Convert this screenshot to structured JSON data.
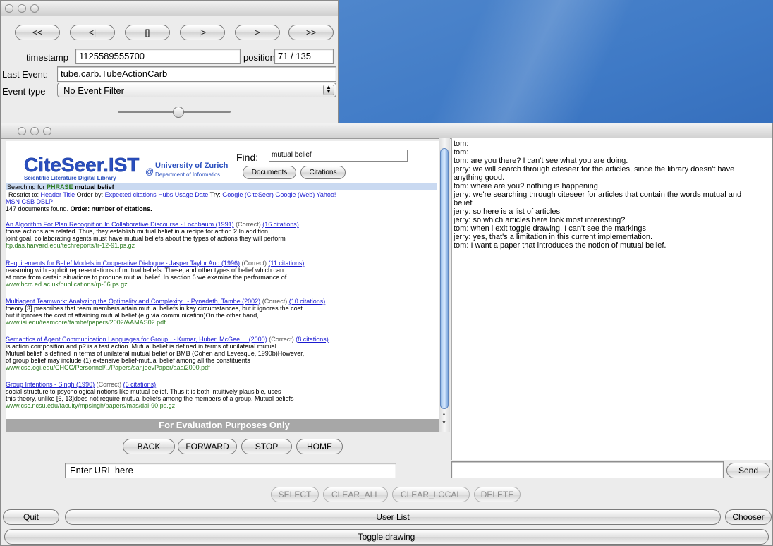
{
  "player": {
    "nav_buttons": [
      "<<",
      "<|",
      "[]",
      "|>",
      ">",
      ">>"
    ],
    "timestamp_label": "timestamp",
    "timestamp_value": "1125589555700",
    "position_label": "position",
    "position_value": "71 / 135",
    "last_event_label": "Last Event:",
    "last_event_value": "tube.carb.TubeActionCarb",
    "event_type_label": "Event type",
    "event_type_value": "No Event Filter"
  },
  "browser": {
    "brand": "CiteSeer.IST",
    "brand_sub": "Scientific Literature Digital Library",
    "at": "@",
    "uni": "University of Zurich",
    "dept": "Department of Informatics",
    "find_label": "Find:",
    "find_value": "mutual belief",
    "documents_btn": "Documents",
    "citations_btn": "Citations",
    "searching_prefix": "Searching for",
    "searching_phrase": "PHRASE",
    "searching_term": "mutual belief",
    "restrict_label": "Restrict to:",
    "restrict_links": [
      "Header",
      "Title"
    ],
    "order_label": "Order by:",
    "order_links": [
      "Expected citations",
      "Hubs",
      "Usage",
      "Date"
    ],
    "try_label": "Try:",
    "try_links": [
      "Google (CiteSeer)",
      "Google (Web)",
      "Yahoo!",
      "MSN",
      "CSB",
      "DBLP"
    ],
    "count_text": "147 documents found.",
    "order_text": "Order: number of citations.",
    "results": [
      {
        "title": "An Algorithm For Plan Recognition In Collaborative Discourse - Lochbaum (1991)",
        "status": "(Correct)",
        "cites": "(16 citations)",
        "lines": [
          "those actions are related. Thus, they establish mutual belief in a recipe for action 2 In addition,",
          "joint goal, collaborating agents must have mutual beliefs about the types of actions they will perform"
        ],
        "url": "ftp.das.harvard.edu/techreports/tr-12-91.ps.gz"
      },
      {
        "title": "Requirements for Belief Models in Cooperative Dialogue - Jasper Taylor And (1996)",
        "status": "(Correct)",
        "cites": "(11 citations)",
        "lines": [
          "reasoning with explicit representations of mutual beliefs. These, and other types of belief which can",
          "at once from certain situations to produce mutual belief. In section 6 we examine the performance of"
        ],
        "url": "www.hcrc.ed.ac.uk/publications/rp-66.ps.gz"
      },
      {
        "title": "Multiagent Teamwork: Analyzing the Optimality and Complexity.. - Pynadath, Tambe (2002)",
        "status": "(Correct)",
        "cites": "(10 citations)",
        "lines": [
          "theory [3] prescribes that team members attain mutual beliefs in key circumstances, but it ignores the cost",
          "but it ignores the cost of attaining mutual belief (e.g.via communication)On the other hand,"
        ],
        "url": "www.isi.edu/teamcore/tambe/papers/2002/AAMAS02.pdf"
      },
      {
        "title": "Semantics of Agent Communication Languages for Group.. - Kumar, Huber, McGee, .. (2000)",
        "status": "(Correct)",
        "cites": "(8 citations)",
        "lines": [
          "is action composition and p? is a test action. Mutual belief is defined in terms of unilateral mutual",
          "Mutual belief is defined in terms of unilateral mutual belief or BMB (Cohen and Levesque, 1990b)However,",
          "of group belief may include (1) extensive belief-mutual belief among all the constituents"
        ],
        "url": "www.cse.ogi.edu/CHCC/Personnel/../Papers/sanjeevPaper/aaai2000.pdf"
      },
      {
        "title": "Group Intentions - Singh (1990)",
        "status": "(Correct)",
        "cites": "(6 citations)",
        "lines": [
          "social structure to psychological notions like mutual belief. Thus it is both intuitively plausible, uses",
          "this theory, unlike [6, 13]does not require mutual beliefs among the members of a group. Mutual beliefs"
        ],
        "url": "www.csc.ncsu.edu/faculty/mpsingh/papers/mas/dai-90.ps.gz"
      }
    ],
    "watermark": "For Evaluation Purposes Only",
    "back_btn": "BACK",
    "forward_btn": "FORWARD",
    "stop_btn": "STOP",
    "home_btn": "HOME",
    "url_value": "Enter URL here"
  },
  "chat": {
    "lines": [
      "tom:",
      "tom:",
      "tom: are you there?  I can't see what you are doing.",
      "jerry: we will search through citeseer for the articles, since the library doesn't have",
      "anything good.",
      "tom: where are you?  nothing is happening",
      "jerry: we're searching through citeseer for articles that contain the words mutual and",
      "belief",
      "jerry: so here is a list of articles",
      "jerry: so which articles here look most interesting?",
      "tom: when i exit toggle drawing, I can't see the markings",
      "jerry: yes, that's a limitation in this current implementation.",
      "tom: I want a paper that introduces the notion of mutual belief."
    ],
    "send_btn": "Send"
  },
  "bottom": {
    "select_btn": "SELECT",
    "clear_all_btn": "CLEAR_ALL",
    "clear_local_btn": "CLEAR_LOCAL",
    "delete_btn": "DELETE",
    "quit_btn": "Quit",
    "user_list_btn": "User List",
    "chooser_btn": "Chooser",
    "toggle_btn": "Toggle drawing"
  }
}
